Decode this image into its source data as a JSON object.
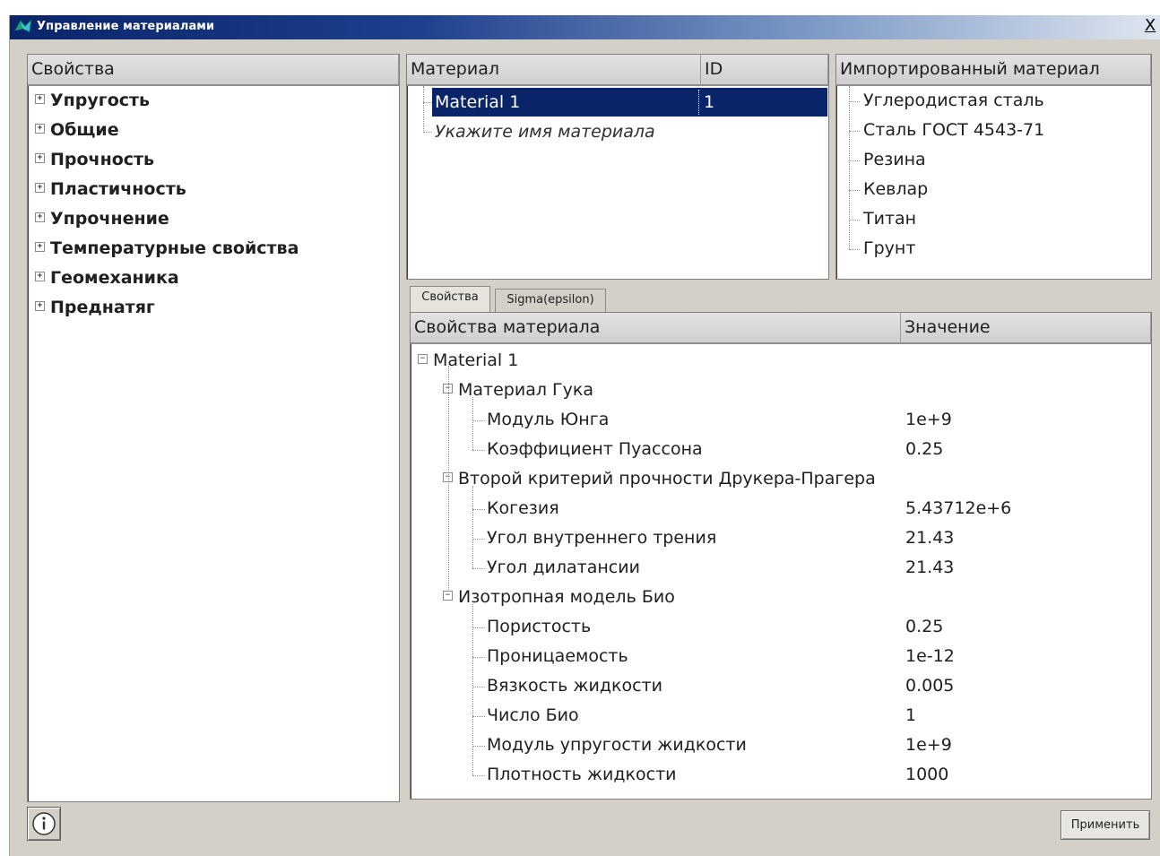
{
  "window": {
    "title": "Управление материалами",
    "close_label": "X"
  },
  "properties_panel": {
    "header": "Свойства",
    "items": [
      {
        "label": "Упругость",
        "expander": "+"
      },
      {
        "label": "Общие",
        "expander": "+"
      },
      {
        "label": "Прочность",
        "expander": "+"
      },
      {
        "label": "Пластичность",
        "expander": "+"
      },
      {
        "label": "Упрочнение",
        "expander": "+"
      },
      {
        "label": "Температурные свойства",
        "expander": "+"
      },
      {
        "label": "Геомеханика",
        "expander": "+"
      },
      {
        "label": "Преднатяг",
        "expander": "+"
      }
    ]
  },
  "material_panel": {
    "columns": [
      "Материал",
      "ID"
    ],
    "rows": [
      {
        "name": "Material 1",
        "id": "1",
        "selected": true
      }
    ],
    "placeholder": "Укажите имя материала"
  },
  "imported_panel": {
    "header": "Импортированный материал",
    "items": [
      "Углеродистая сталь",
      "Сталь ГОСТ 4543-71",
      "Резина",
      "Кевлар",
      "Титан",
      "Грунт"
    ]
  },
  "tabs": [
    {
      "label": "Свойства",
      "active": true
    },
    {
      "label": "Sigma(epsilon)",
      "active": false
    }
  ],
  "material_properties": {
    "columns": [
      "Свойства материала",
      "Значение"
    ],
    "root": {
      "label": "Material 1",
      "expander": "−"
    },
    "groups": [
      {
        "label": "Материал Гука",
        "expander": "−",
        "props": [
          {
            "name": "Модуль Юнга",
            "value": "1e+9"
          },
          {
            "name": "Коэффициент Пуассона",
            "value": "0.25"
          }
        ]
      },
      {
        "label": "Второй критерий прочности Друкера-Прагера",
        "expander": "−",
        "props": [
          {
            "name": "Когезия",
            "value": "5.43712e+6"
          },
          {
            "name": "Угол внутреннего трения",
            "value": "21.43"
          },
          {
            "name": "Угол дилатансии",
            "value": "21.43"
          }
        ]
      },
      {
        "label": "Изотропная модель Био",
        "expander": "−",
        "props": [
          {
            "name": "Пористость",
            "value": "0.25"
          },
          {
            "name": "Проницаемость",
            "value": "1e-12"
          },
          {
            "name": "Вязкость жидкости",
            "value": "0.005"
          },
          {
            "name": "Число Био",
            "value": "1"
          },
          {
            "name": "Модуль упругости жидкости",
            "value": "1e+9"
          },
          {
            "name": "Плотность жидкости",
            "value": "1000"
          }
        ]
      }
    ]
  },
  "buttons": {
    "info_icon": "info-icon",
    "apply_label": "Применить"
  },
  "colors": {
    "selection": "#0a246a",
    "titlebar_start": "#0a246a",
    "titlebar_end": "#dfe6f0",
    "dialog_bg": "#d4d0c8"
  }
}
